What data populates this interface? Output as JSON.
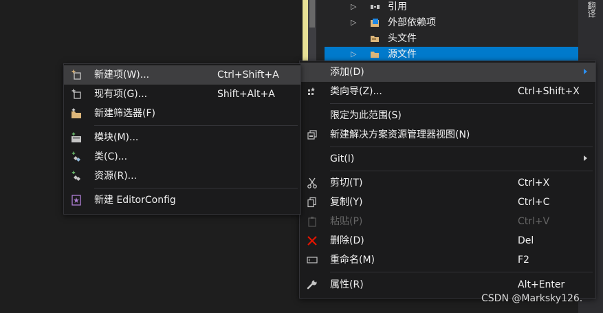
{
  "solution_explorer": {
    "items": [
      {
        "label": "引用",
        "icon": "reference-icon"
      },
      {
        "label": "外部依赖项",
        "icon": "external-deps-icon"
      },
      {
        "label": "头文件",
        "icon": "header-folder-icon"
      },
      {
        "label": "源文件",
        "icon": "source-folder-icon",
        "selected": true
      }
    ]
  },
  "right_strip": {
    "tab_label": "翻译"
  },
  "context_menu": {
    "items": [
      {
        "label": "添加(D)",
        "shortcut": "",
        "submenu": true,
        "highlighted": true
      },
      {
        "label": "类向导(Z)...",
        "shortcut": "Ctrl+Shift+X",
        "icon": "class-wizard-icon"
      },
      {
        "label": "限定为此范围(S)",
        "shortcut": ""
      },
      {
        "label": "新建解决方案资源管理器视图(N)",
        "shortcut": "",
        "icon": "new-view-icon"
      },
      {
        "label": "Git(I)",
        "shortcut": "",
        "submenu": true
      },
      {
        "label": "剪切(T)",
        "shortcut": "Ctrl+X",
        "icon": "cut-icon"
      },
      {
        "label": "复制(Y)",
        "shortcut": "Ctrl+C",
        "icon": "copy-icon"
      },
      {
        "label": "粘贴(P)",
        "shortcut": "Ctrl+V",
        "icon": "paste-icon",
        "disabled": true
      },
      {
        "label": "删除(D)",
        "shortcut": "Del",
        "icon": "delete-icon"
      },
      {
        "label": "重命名(M)",
        "shortcut": "F2",
        "icon": "rename-icon"
      },
      {
        "label": "属性(R)",
        "shortcut": "Alt+Enter",
        "icon": "properties-icon"
      }
    ]
  },
  "add_submenu": {
    "items": [
      {
        "label": "新建项(W)...",
        "shortcut": "Ctrl+Shift+A",
        "icon": "new-item-icon",
        "highlighted": true
      },
      {
        "label": "现有项(G)...",
        "shortcut": "Shift+Alt+A",
        "icon": "existing-item-icon"
      },
      {
        "label": "新建筛选器(F)",
        "shortcut": "",
        "icon": "new-filter-icon"
      },
      {
        "label": "模块(M)...",
        "shortcut": "",
        "icon": "module-icon"
      },
      {
        "label": "类(C)...",
        "shortcut": "",
        "icon": "class-icon"
      },
      {
        "label": "资源(R)...",
        "shortcut": "",
        "icon": "resource-icon"
      },
      {
        "label": "新建 EditorConfig",
        "shortcut": "",
        "icon": "editorconfig-icon"
      }
    ]
  },
  "watermark": "CSDN @Marksky126.",
  "colors": {
    "selection": "#007acc",
    "menu_bg": "#1b1b1c",
    "menu_highlight": "#3e3e40",
    "delete_red": "#e51400",
    "folder_yellow": "#dcb67a"
  }
}
